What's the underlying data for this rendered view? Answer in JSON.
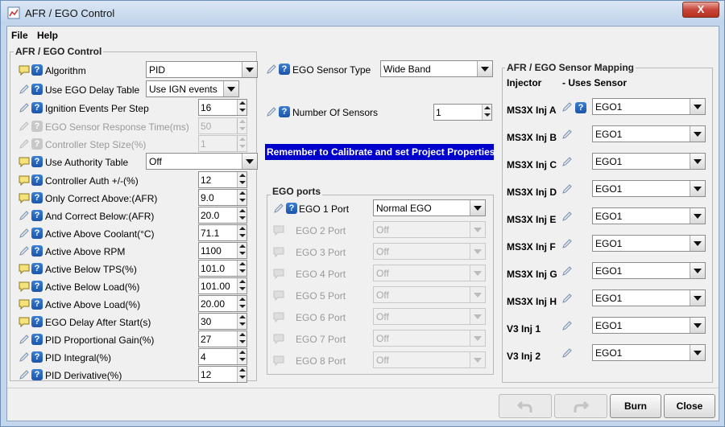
{
  "window": {
    "title": "AFR / EGO Control",
    "close_glyph": "X"
  },
  "menu": {
    "file": "File",
    "help": "Help"
  },
  "left": {
    "title": "AFR / EGO Control",
    "rows": [
      {
        "label": "Algorithm",
        "kind": "combo",
        "value": "PID",
        "icon": "note",
        "enabled": true
      },
      {
        "label": "Use EGO Delay Table",
        "kind": "combo",
        "value": "Use IGN events",
        "icon": "pen",
        "enabled": true
      },
      {
        "label": "Ignition Events Per Step",
        "kind": "spin",
        "value": "16",
        "icon": "pen",
        "enabled": true
      },
      {
        "label": "EGO Sensor Response Time(ms)",
        "kind": "spin",
        "value": "50",
        "icon": "pen",
        "enabled": false
      },
      {
        "label": "Controller Step Size(%)",
        "kind": "spin",
        "value": "1",
        "icon": "pen",
        "enabled": false
      },
      {
        "label": "Use Authority Table",
        "kind": "combo",
        "value": "Off",
        "icon": "note",
        "enabled": true
      },
      {
        "label": "Controller Auth +/-(%)",
        "kind": "spin",
        "value": "12",
        "icon": "note",
        "enabled": true
      },
      {
        "label": "Only Correct Above:(AFR)",
        "kind": "spin",
        "value": "9.0",
        "icon": "note",
        "enabled": true
      },
      {
        "label": "And Correct Below:(AFR)",
        "kind": "spin",
        "value": "20.0",
        "icon": "pen",
        "enabled": true
      },
      {
        "label": "Active Above Coolant(°C)",
        "kind": "spin",
        "value": "71.1",
        "icon": "pen",
        "enabled": true
      },
      {
        "label": "Active Above RPM",
        "kind": "spin",
        "value": "1100",
        "icon": "pen",
        "enabled": true
      },
      {
        "label": "Active Below TPS(%)",
        "kind": "spin",
        "value": "101.0",
        "icon": "note",
        "enabled": true
      },
      {
        "label": "Active Below Load(%)",
        "kind": "spin",
        "value": "101.00",
        "icon": "note",
        "enabled": true
      },
      {
        "label": "Active Above Load(%)",
        "kind": "spin",
        "value": "20.00",
        "icon": "note",
        "enabled": true
      },
      {
        "label": "EGO Delay After Start(s)",
        "kind": "spin",
        "value": "30",
        "icon": "note",
        "enabled": true
      },
      {
        "label": "PID Proportional Gain(%)",
        "kind": "spin",
        "value": "27",
        "icon": "pen",
        "enabled": true
      },
      {
        "label": "PID Integral(%)",
        "kind": "spin",
        "value": "4",
        "icon": "pen",
        "enabled": true
      },
      {
        "label": "PID Derivative(%)",
        "kind": "spin",
        "value": "12",
        "icon": "pen",
        "enabled": true
      }
    ]
  },
  "middle": {
    "sensor_type_label": "EGO Sensor Type",
    "sensor_type_value": "Wide Band",
    "num_sensors_label": "Number Of Sensors",
    "num_sensors_value": "1",
    "banner": "Remember to Calibrate and set Project Properties",
    "ego_ports_title": "EGO ports",
    "ports": [
      {
        "label": "EGO 1 Port",
        "value": "Normal EGO",
        "enabled": true
      },
      {
        "label": "EGO 2 Port",
        "value": "Off",
        "enabled": false
      },
      {
        "label": "EGO 3 Port",
        "value": "Off",
        "enabled": false
      },
      {
        "label": "EGO 4 Port",
        "value": "Off",
        "enabled": false
      },
      {
        "label": "EGO 5 Port",
        "value": "Off",
        "enabled": false
      },
      {
        "label": "EGO 6 Port",
        "value": "Off",
        "enabled": false
      },
      {
        "label": "EGO 7 Port",
        "value": "Off",
        "enabled": false
      },
      {
        "label": "EGO 8 Port",
        "value": "Off",
        "enabled": false
      }
    ]
  },
  "right": {
    "title": "AFR / EGO Sensor Mapping",
    "col_injector": "Injector",
    "col_sensor": "- Uses Sensor",
    "rows": [
      {
        "injector": "MS3X Inj A",
        "sensor": "EGO1"
      },
      {
        "injector": "MS3X Inj B",
        "sensor": "EGO1"
      },
      {
        "injector": "MS3X Inj C",
        "sensor": "EGO1"
      },
      {
        "injector": "MS3X Inj D",
        "sensor": "EGO1"
      },
      {
        "injector": "MS3X Inj E",
        "sensor": "EGO1"
      },
      {
        "injector": "MS3X Inj F",
        "sensor": "EGO1"
      },
      {
        "injector": "MS3X Inj G",
        "sensor": "EGO1"
      },
      {
        "injector": "MS3X Inj H",
        "sensor": "EGO1"
      },
      {
        "injector": "V3 Inj 1",
        "sensor": "EGO1"
      },
      {
        "injector": "V3 Inj 2",
        "sensor": "EGO1"
      }
    ]
  },
  "buttons": {
    "burn": "Burn",
    "close": "Close"
  },
  "colors": {
    "banner_bg": "#0000cc",
    "help_blue": "#1c54a8"
  }
}
